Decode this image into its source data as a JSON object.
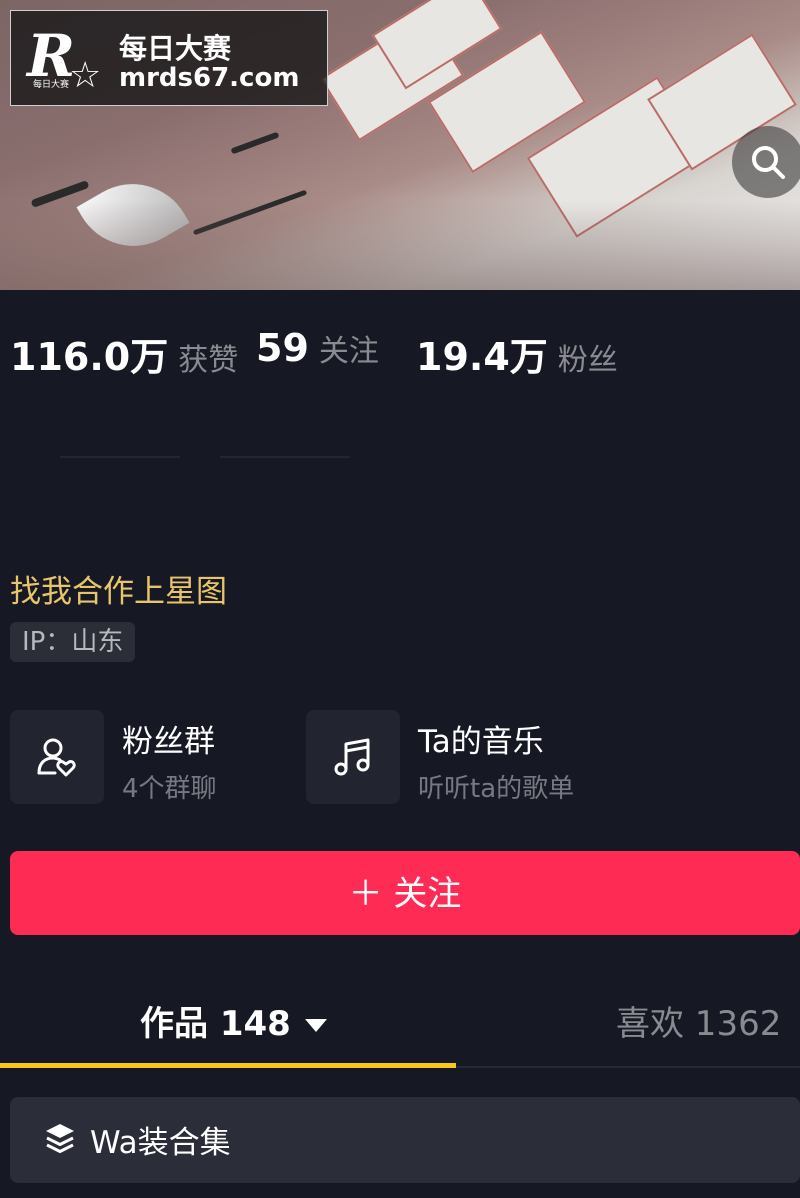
{
  "watermark": {
    "logo_letter": "R",
    "logo_small": "每日大赛",
    "title": "每日大赛",
    "url": "mrds67.com"
  },
  "icons": {
    "search": "search-icon",
    "fan_group": "user-heart-icon",
    "music": "music-note-icon",
    "collection": "layers-icon",
    "caret": "caret-down-icon"
  },
  "stats": [
    {
      "value": "116.0万",
      "label": "获赞"
    },
    {
      "value": "59",
      "label": "关注"
    },
    {
      "value": "19.4万",
      "label": "粉丝"
    }
  ],
  "profile": {
    "link_text": "找我合作上星图",
    "ip_tag": "IP：山东"
  },
  "features": [
    {
      "title": "粉丝群",
      "subtitle": "4个群聊"
    },
    {
      "title": "Ta的音乐",
      "subtitle": "听听ta的歌单"
    }
  ],
  "follow_button": {
    "label": "＋ 关注"
  },
  "tabs": {
    "works": "作品 148",
    "likes": "喜欢 1362"
  },
  "collection": {
    "label": "Wa装合集"
  },
  "colors": {
    "background": "#161823",
    "accent_red": "#fe2c55",
    "accent_yellow": "#f8c81c",
    "link_gold": "#e8c46a"
  }
}
